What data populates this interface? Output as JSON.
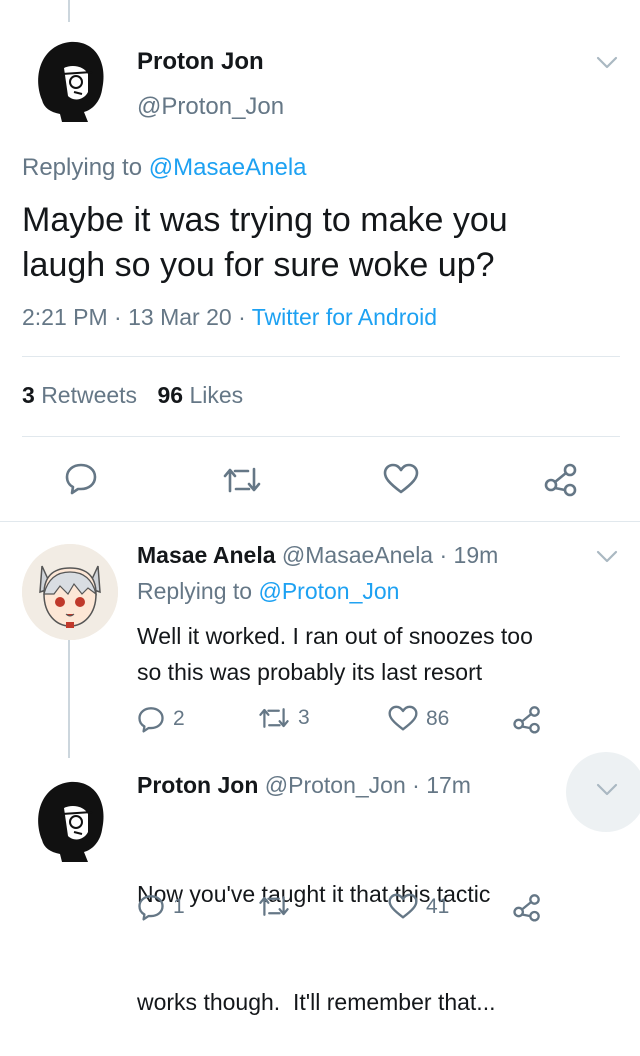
{
  "main_tweet": {
    "name": "Proton Jon",
    "handle": "@Proton_Jon",
    "replying_prefix": "Replying to",
    "replying_handle": "@MasaeAnela",
    "text_line1": "Maybe it was trying to make you",
    "text_line2": "laugh so you for sure woke up?",
    "time": "2:21 PM",
    "date": "13 Mar 20",
    "separator": "·",
    "source": "Twitter for Android",
    "retweets_count": "3",
    "retweets_label": "Retweets",
    "likes_count": "96",
    "likes_label": "Likes"
  },
  "replies": [
    {
      "name": "Masae Anela",
      "handle": "@MasaeAnela",
      "time": "· 19m",
      "replying_prefix": "Replying to",
      "replying_handle": "@Proton_Jon",
      "text_line1": "Well it worked. I ran out of snoozes too",
      "text_line2": "so this was probably its last resort",
      "reply_count": "2",
      "retweet_count": "3",
      "like_count": "86"
    },
    {
      "name": "Proton Jon",
      "handle": "@Proton_Jon",
      "time": "· 17m",
      "text_line1": "Now you've taught it that this tactic",
      "text_line2": "works though.  It'll remember that...",
      "reply_count": "1",
      "retweet_count": "",
      "like_count": "41"
    }
  ],
  "colors": {
    "accent": "#1da1f2",
    "muted": "#657786",
    "text": "#14171a",
    "divider": "#e1e8ed"
  },
  "icons": [
    "chevron-down-icon",
    "reply-icon",
    "retweet-icon",
    "like-icon",
    "share-icon"
  ]
}
